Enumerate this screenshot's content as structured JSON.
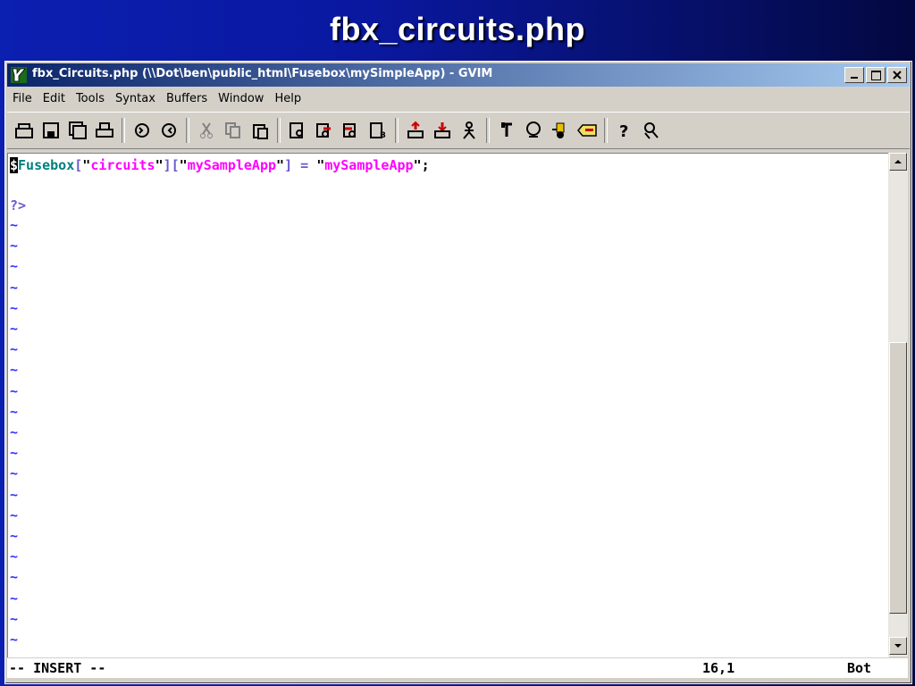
{
  "slide": {
    "title": "fbx_circuits.php"
  },
  "window": {
    "caption": "fbx_Circuits.php (\\\\Dot\\ben\\public_html\\Fusebox\\mySimpleApp) - GVIM",
    "buttons": {
      "minimize": "_",
      "maximize": "□",
      "close": "×"
    }
  },
  "menu": [
    "File",
    "Edit",
    "Tools",
    "Syntax",
    "Buffers",
    "Window",
    "Help"
  ],
  "toolbar": {
    "icons": [
      "open-icon",
      "save-icon",
      "save-all-icon",
      "print-icon",
      "undo-icon",
      "redo-icon",
      "cut-icon",
      "copy-icon",
      "paste-icon",
      "find-icon",
      "find-next-icon",
      "find-prev-icon",
      "load-session-icon",
      "save-session-icon",
      "run-script-icon",
      "make-icon",
      "shell-icon",
      "build-tags-icon",
      "tag-jump-icon",
      "help-icon",
      "find-help-icon"
    ]
  },
  "editor": {
    "code_line": {
      "cursor_char": "$",
      "var": "Fusebox",
      "b1": "[",
      "q1": "\"",
      "s1": "circuits",
      "q2": "\"",
      "b2": "][",
      "q3": "\"",
      "s2": "mySampleApp",
      "q4": "\"",
      "b3": "]",
      "eq": " = ",
      "q5": "\"",
      "s3": "mySampleApp",
      "q6": "\"",
      "semi": ";"
    },
    "php_close": "?>",
    "tilde": "~",
    "tilde_count": 21
  },
  "status": {
    "mode": "-- INSERT --",
    "position": "16,1",
    "scroll": "Bot"
  },
  "colors": {
    "variable": "#008080",
    "bracket": "#6a5acd",
    "string": "#ff00ff",
    "text": "#000000",
    "tilde": "#3333ff"
  }
}
